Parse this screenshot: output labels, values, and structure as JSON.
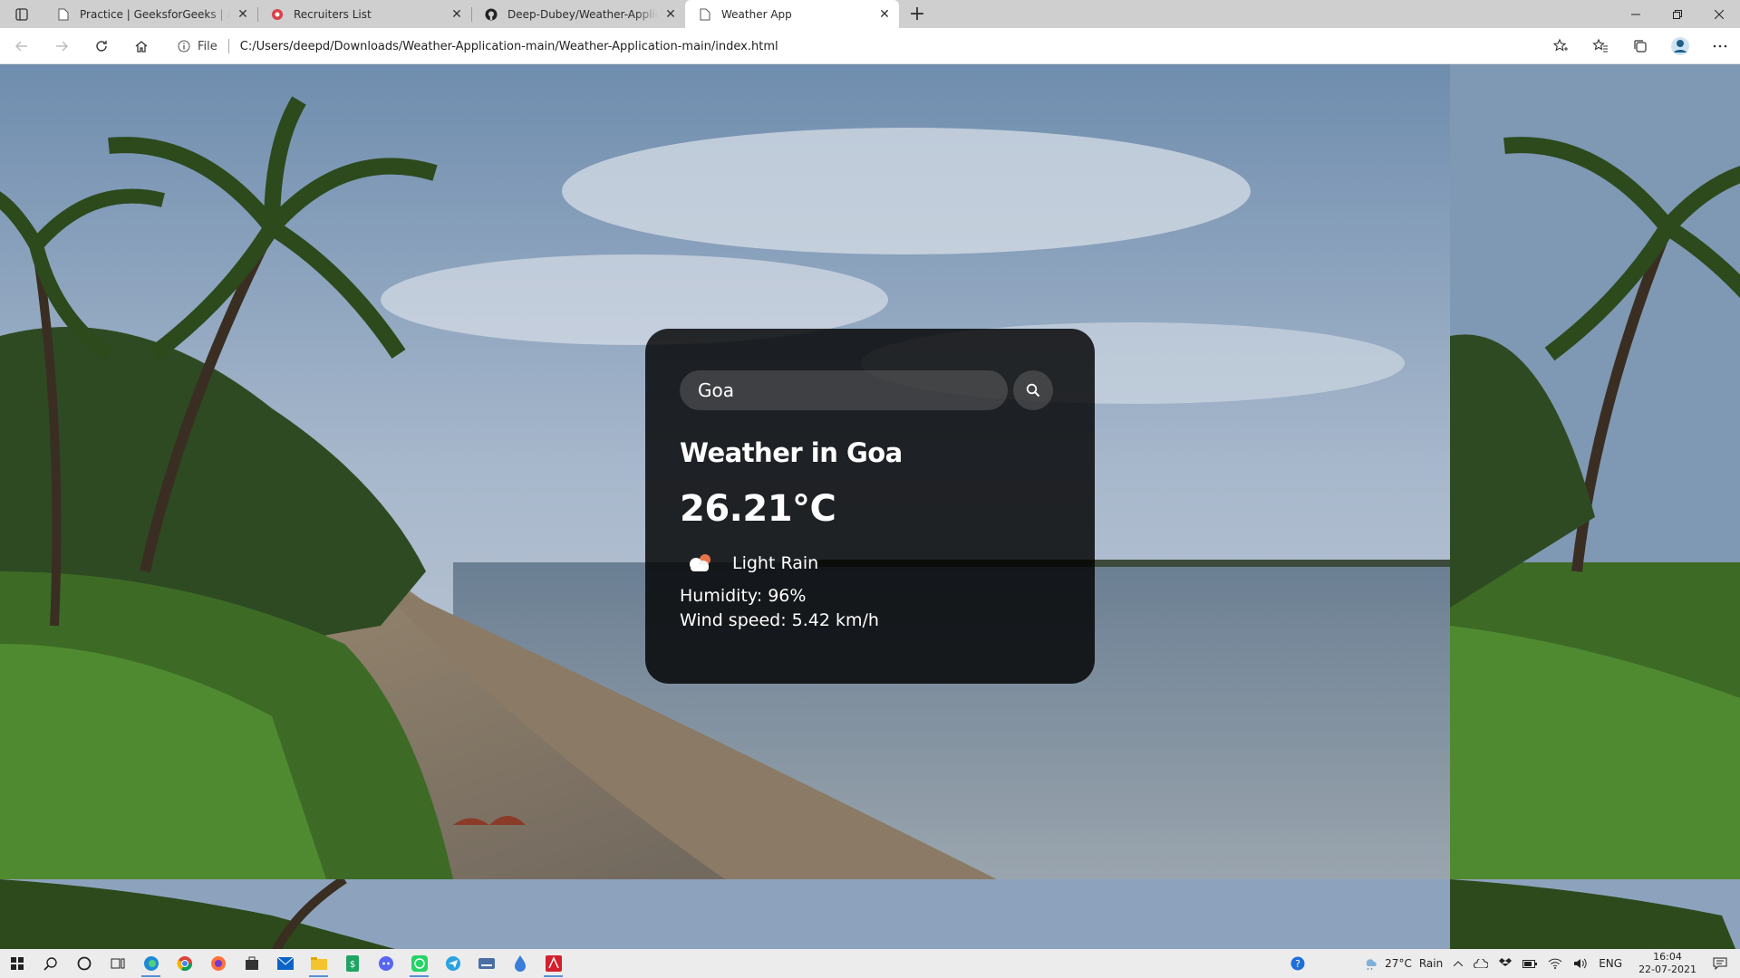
{
  "browser": {
    "tabs": [
      {
        "title": "Practice | GeeksforGeeks | A computer science portal",
        "icon": "page-icon",
        "active": false
      },
      {
        "title": "Recruiters List",
        "icon": "recruiters-icon",
        "active": false
      },
      {
        "title": "Deep-Dubey/Weather-Application-main",
        "icon": "github-icon",
        "active": false
      },
      {
        "title": "Weather App",
        "icon": "page-icon",
        "active": true
      }
    ],
    "address_label": "File",
    "url": "C:/Users/deepd/Downloads/Weather-Application-main/Weather-Application-main/index.html"
  },
  "app": {
    "search": {
      "value": "Goa",
      "placeholder": "Search"
    },
    "city_heading": "Weather in Goa",
    "temperature": "26.21°C",
    "description": "Light Rain",
    "weather_icon": "cloud-rain-icon",
    "humidity": "Humidity: 96%",
    "wind": "Wind speed: 5.42 km/h"
  },
  "taskbar": {
    "apps": [
      "start-icon",
      "search-icon",
      "cortana-icon",
      "task-view-icon",
      "edge-icon",
      "chrome-icon",
      "firefox-icon",
      "store-icon",
      "mail-icon",
      "file-explorer-icon",
      "sheets-icon",
      "discord-icon",
      "whatsapp-icon",
      "telegram-icon",
      "keyboard-icon",
      "drop-icon",
      "acrobat-icon"
    ],
    "weather_temp": "27°C",
    "weather_text": "Rain",
    "language": "ENG",
    "time": "16:04",
    "date": "22-07-2021"
  },
  "colors": {
    "card_bg": "#000000",
    "text": "#ffffff",
    "accent": "#5a8fd6"
  }
}
